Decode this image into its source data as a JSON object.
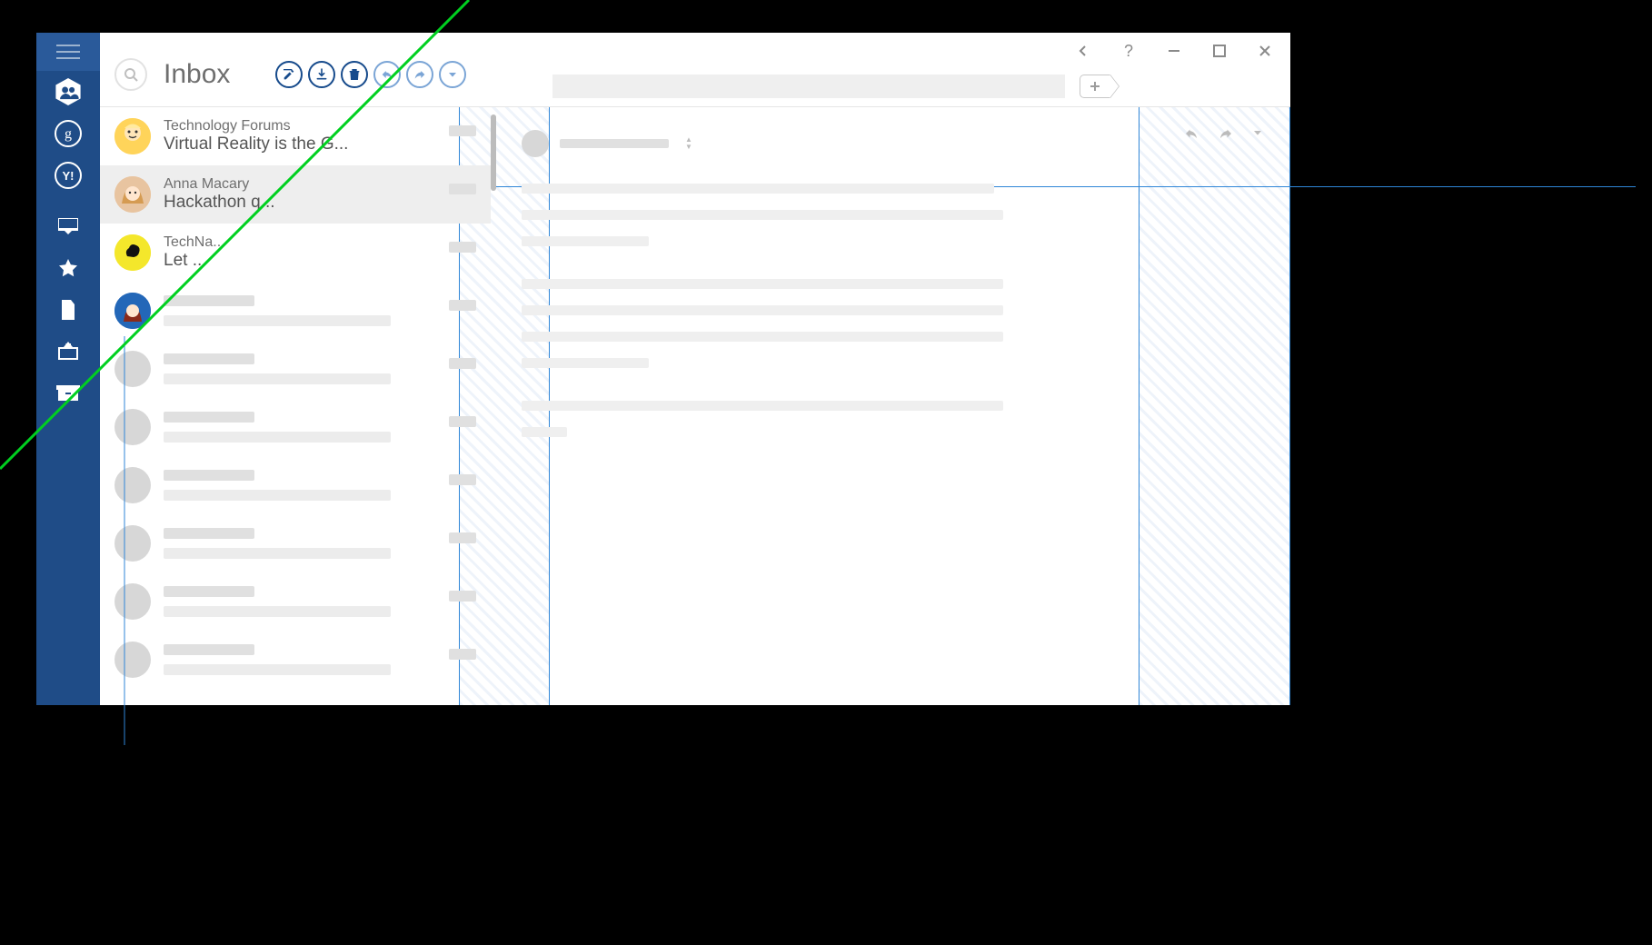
{
  "header": {
    "title": "Inbox",
    "search_placeholder": "Search"
  },
  "sidebar": {
    "items": [
      "menu",
      "contacts",
      "google",
      "yahoo",
      "inbox",
      "starred",
      "drafts",
      "sent",
      "archive"
    ]
  },
  "toolbar": {
    "icons": [
      "compose",
      "download",
      "delete",
      "reply",
      "forward",
      "more"
    ]
  },
  "window_controls": [
    "back",
    "help",
    "minimize",
    "maximize",
    "close"
  ],
  "messages": [
    {
      "sender": "Technology Forums",
      "subject": "Virtual Reality is the G...",
      "avatar_bg": "#ffd45a",
      "avatar_type": "face1"
    },
    {
      "sender": "Anna Macary",
      "subject": "Hackathon q...",
      "avatar_bg": "#f1c6a0",
      "avatar_type": "face2",
      "selected": true
    },
    {
      "sender": "TechNa...",
      "subject": "Let ...",
      "avatar_bg": "#f4e72b",
      "avatar_type": "deer"
    },
    {
      "sender": "",
      "subject": "",
      "avatar_bg": "#2367b8",
      "avatar_type": "face3",
      "ghost": true
    }
  ],
  "reader_actions": [
    "reply",
    "forward",
    "more"
  ]
}
